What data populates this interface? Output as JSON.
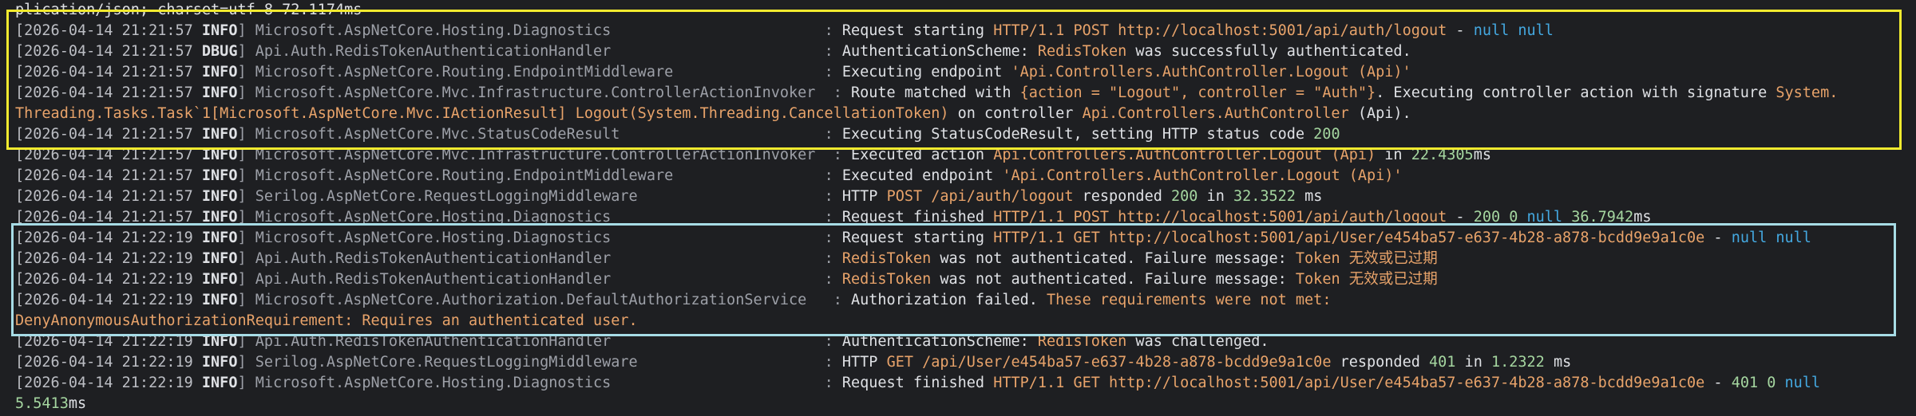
{
  "colors": {
    "background": "#1e1f22",
    "timestamp": "#bcbec4",
    "level": "#dfe1e5",
    "source": "#9da0a8",
    "message": "#dfe1e5",
    "orange": "#e8a36a",
    "blue": "#44a8e0",
    "green": "#a5d6a0",
    "highlight_box_1": "#f1ea2f",
    "highlight_box_2": "#a7dce6"
  },
  "log": [
    {
      "cont": [
        [
          "default",
          "plication/json; charset=utf-8 72.1174ms"
        ]
      ]
    },
    {
      "ts": "[2026-04-14 21:21:57 ",
      "lvl": "INFO",
      "src": "] Microsoft.AspNetCore.Hosting.Diagnostics                        : ",
      "msg": [
        [
          "default",
          "Request starting "
        ],
        [
          "orange",
          "HTTP/1.1 POST "
        ],
        [
          "orange",
          "http://localhost:5001/api/auth/logout"
        ],
        [
          "default",
          " - "
        ],
        [
          "blue",
          "null null"
        ]
      ]
    },
    {
      "ts": "[2026-04-14 21:21:57 ",
      "lvl": "DBUG",
      "src": "] Api.Auth.RedisTokenAuthenticationHandler                        : ",
      "msg": [
        [
          "default",
          "AuthenticationScheme: "
        ],
        [
          "orange",
          "RedisToken"
        ],
        [
          "default",
          " was successfully authenticated."
        ]
      ]
    },
    {
      "ts": "[2026-04-14 21:21:57 ",
      "lvl": "INFO",
      "src": "] Microsoft.AspNetCore.Routing.EndpointMiddleware                 : ",
      "msg": [
        [
          "default",
          "Executing endpoint "
        ],
        [
          "orange",
          "'Api.Controllers.AuthController.Logout (Api)'"
        ]
      ]
    },
    {
      "ts": "[2026-04-14 21:21:57 ",
      "lvl": "INFO",
      "src": "] Microsoft.AspNetCore.Mvc.Infrastructure.ControllerActionInvoker  : ",
      "msg": [
        [
          "default",
          "Route matched with "
        ],
        [
          "orange",
          "{action = \"Logout\", controller = \"Auth\"}"
        ],
        [
          "default",
          ". Executing controller action with signature "
        ],
        [
          "orange",
          "System."
        ]
      ]
    },
    {
      "cont": [
        [
          "orange",
          "Threading.Tasks.Task`1[Microsoft.AspNetCore.Mvc.IActionResult] Logout(System.Threading.CancellationToken)"
        ],
        [
          "default",
          " on controller "
        ],
        [
          "orange",
          "Api.Controllers.AuthController"
        ],
        [
          "default",
          " (Api)."
        ]
      ]
    },
    {
      "ts": "[2026-04-14 21:21:57 ",
      "lvl": "INFO",
      "src": "] Microsoft.AspNetCore.Mvc.StatusCodeResult                       : ",
      "msg": [
        [
          "default",
          "Executing StatusCodeResult, setting HTTP status code "
        ],
        [
          "green",
          "200"
        ]
      ]
    },
    {
      "ts": "[2026-04-14 21:21:57 ",
      "lvl": "INFO",
      "src": "] Microsoft.AspNetCore.Mvc.Infrastructure.ControllerActionInvoker  : ",
      "msg": [
        [
          "default",
          "Executed action "
        ],
        [
          "orange",
          "Api.Controllers.AuthController.Logout (Api)"
        ],
        [
          "default",
          " in "
        ],
        [
          "green",
          "22.4305"
        ],
        [
          "default",
          "ms"
        ]
      ]
    },
    {
      "ts": "[2026-04-14 21:21:57 ",
      "lvl": "INFO",
      "src": "] Microsoft.AspNetCore.Routing.EndpointMiddleware                 : ",
      "msg": [
        [
          "default",
          "Executed endpoint "
        ],
        [
          "orange",
          "'Api.Controllers.AuthController.Logout (Api)'"
        ]
      ]
    },
    {
      "ts": "[2026-04-14 21:21:57 ",
      "lvl": "INFO",
      "src": "] Serilog.AspNetCore.RequestLoggingMiddleware                     : ",
      "msg": [
        [
          "default",
          "HTTP "
        ],
        [
          "orange",
          "POST /api/auth/logout"
        ],
        [
          "default",
          " responded "
        ],
        [
          "green",
          "200"
        ],
        [
          "default",
          " in "
        ],
        [
          "green",
          "32.3522"
        ],
        [
          "default",
          " ms"
        ]
      ]
    },
    {
      "ts": "[2026-04-14 21:21:57 ",
      "lvl": "INFO",
      "src": "] Microsoft.AspNetCore.Hosting.Diagnostics                        : ",
      "msg": [
        [
          "default",
          "Request finished "
        ],
        [
          "orange",
          "HTTP/1.1 POST "
        ],
        [
          "orange",
          "http://localhost:5001/api/auth/logout"
        ],
        [
          "default",
          " - "
        ],
        [
          "green",
          "200 0 "
        ],
        [
          "blue",
          "null "
        ],
        [
          "green",
          "36.7942"
        ],
        [
          "default",
          "ms"
        ]
      ]
    },
    {
      "ts": "[2026-04-14 21:22:19 ",
      "lvl": "INFO",
      "src": "] Microsoft.AspNetCore.Hosting.Diagnostics                        : ",
      "msg": [
        [
          "default",
          "Request starting "
        ],
        [
          "orange",
          "HTTP/1.1 GET "
        ],
        [
          "orange",
          "http://localhost:5001/api/User/e454ba57-e637-4b28-a878-bcdd9e9a1c0e"
        ],
        [
          "default",
          " - "
        ],
        [
          "blue",
          "null null"
        ]
      ]
    },
    {
      "ts": "[2026-04-14 21:22:19 ",
      "lvl": "INFO",
      "src": "] Api.Auth.RedisTokenAuthenticationHandler                        : ",
      "msg": [
        [
          "orange",
          "RedisToken"
        ],
        [
          "default",
          " was not authenticated. Failure message: "
        ],
        [
          "orange",
          "Token 无效或已过期"
        ]
      ]
    },
    {
      "ts": "[2026-04-14 21:22:19 ",
      "lvl": "INFO",
      "src": "] Api.Auth.RedisTokenAuthenticationHandler                        : ",
      "msg": [
        [
          "orange",
          "RedisToken"
        ],
        [
          "default",
          " was not authenticated. Failure message: "
        ],
        [
          "orange",
          "Token 无效或已过期"
        ]
      ]
    },
    {
      "ts": "[2026-04-14 21:22:19 ",
      "lvl": "INFO",
      "src": "] Microsoft.AspNetCore.Authorization.DefaultAuthorizationService   : ",
      "msg": [
        [
          "default",
          "Authorization failed. "
        ],
        [
          "orange",
          "These requirements were not met:"
        ]
      ]
    },
    {
      "cont": [
        [
          "orange",
          "DenyAnonymousAuthorizationRequirement: Requires an authenticated user."
        ]
      ]
    },
    {
      "ts": "[2026-04-14 21:22:19 ",
      "lvl": "INFO",
      "src": "] Api.Auth.RedisTokenAuthenticationHandler                        : ",
      "msg": [
        [
          "default",
          "AuthenticationScheme: "
        ],
        [
          "orange",
          "RedisToken"
        ],
        [
          "default",
          " was challenged."
        ]
      ]
    },
    {
      "ts": "[2026-04-14 21:22:19 ",
      "lvl": "INFO",
      "src": "] Serilog.AspNetCore.RequestLoggingMiddleware                     : ",
      "msg": [
        [
          "default",
          "HTTP "
        ],
        [
          "orange",
          "GET /api/User/e454ba57-e637-4b28-a878-bcdd9e9a1c0e"
        ],
        [
          "default",
          " responded "
        ],
        [
          "green",
          "401"
        ],
        [
          "default",
          " in "
        ],
        [
          "green",
          "1.2322"
        ],
        [
          "default",
          " ms"
        ]
      ]
    },
    {
      "ts": "[2026-04-14 21:22:19 ",
      "lvl": "INFO",
      "src": "] Microsoft.AspNetCore.Hosting.Diagnostics                        : ",
      "msg": [
        [
          "default",
          "Request finished "
        ],
        [
          "orange",
          "HTTP/1.1 GET "
        ],
        [
          "orange",
          "http://localhost:5001/api/User/e454ba57-e637-4b28-a878-bcdd9e9a1c0e"
        ],
        [
          "default",
          " - "
        ],
        [
          "green",
          "401 0 "
        ],
        [
          "blue",
          "null"
        ]
      ]
    },
    {
      "cont": [
        [
          "green",
          "5.5413"
        ],
        [
          "default",
          "ms"
        ]
      ]
    }
  ]
}
